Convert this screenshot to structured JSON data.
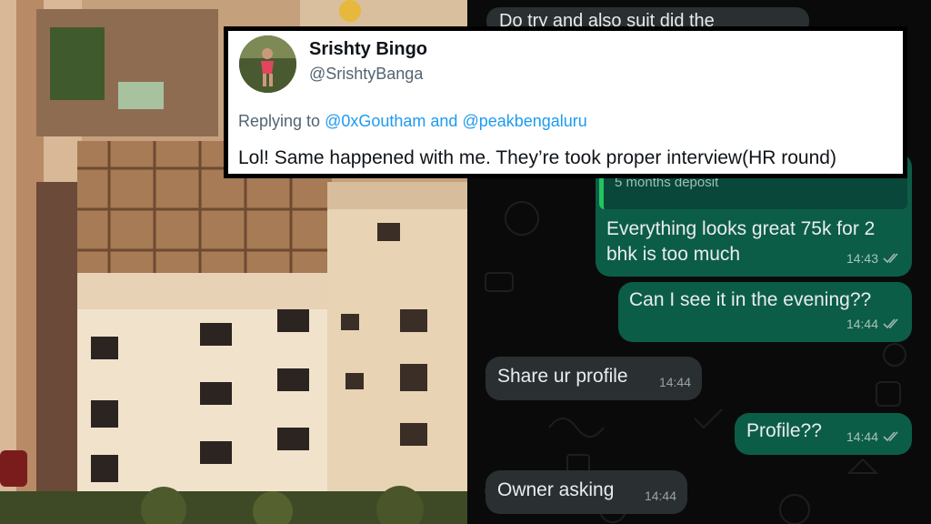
{
  "tweet": {
    "name": "Srishty Bingo",
    "handle": "@SrishtyBanga",
    "replying_prefix": "Replying to ",
    "mention1": "@0xGoutham",
    "and_word": " and ",
    "mention2": "@peakbengaluru",
    "body": "Lol! Same happened with me. They’re took proper interview(HR round)"
  },
  "chat": {
    "top_partial_text": "Do try and also suit did the",
    "quote_text": "5 months deposit",
    "messages": [
      {
        "direction": "out",
        "text": "Everything looks great 75k for 2\nbhk is too much",
        "time": "14:43",
        "read": true
      },
      {
        "direction": "out",
        "text": "Can I see it in the evening??",
        "time": "14:44",
        "read": true
      },
      {
        "direction": "in",
        "text": "Share ur profile",
        "time": "14:44"
      },
      {
        "direction": "out",
        "text": "Profile??",
        "time": "14:44",
        "read": true
      },
      {
        "direction": "in",
        "text": "Owner asking",
        "time": "14:44"
      }
    ]
  },
  "colors": {
    "outgoing_bubble": "#0c5d47",
    "incoming_bubble": "#2a2f31",
    "mention": "#1d9bf0",
    "chat_background": "#0a0a0a"
  },
  "icons": {
    "read_receipt": "double-check-icon",
    "avatar": "profile-photo"
  }
}
